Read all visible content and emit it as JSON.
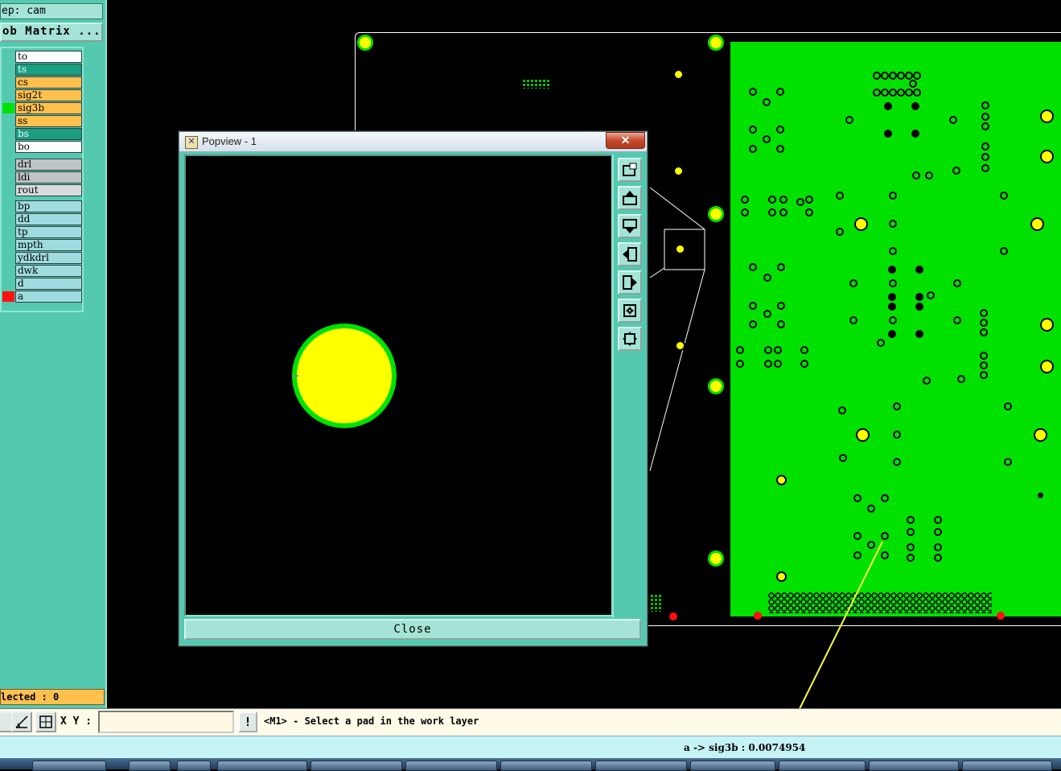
{
  "left_panel": {
    "step_label": "ep: cam",
    "matrix_button": "ob Matrix ...",
    "board_layers": [
      {
        "name": "to",
        "color": "#ffffff"
      },
      {
        "name": "ts",
        "color": "#1a9e80"
      },
      {
        "name": "cs",
        "color": "#ffc04e"
      },
      {
        "name": "sig2t",
        "color": "#ffc04e"
      },
      {
        "name": "sig3b",
        "color": "#ffc04e",
        "swatch": "#00e100"
      },
      {
        "name": "ss",
        "color": "#ffc04e"
      },
      {
        "name": "bs",
        "color": "#1a9e80"
      },
      {
        "name": "bo",
        "color": "#ffffff"
      }
    ],
    "drill_layers": [
      {
        "name": "drl",
        "color": "#bfc4c4"
      },
      {
        "name": "ldi",
        "color": "#bfc4c4"
      },
      {
        "name": "rout",
        "color": "#d8dcdc"
      }
    ],
    "misc_layers": [
      {
        "name": "bp",
        "color": "#9fdce0"
      },
      {
        "name": "dd",
        "color": "#9fdce0"
      },
      {
        "name": "tp",
        "color": "#9fdce0"
      },
      {
        "name": "mpth",
        "color": "#9fdce0"
      },
      {
        "name": "ydkdrl",
        "color": "#9fdce0"
      },
      {
        "name": "dwk",
        "color": "#9fdce0"
      },
      {
        "name": "d",
        "color": "#9fdce0"
      },
      {
        "name": "a",
        "color": "#9fdce0",
        "swatch": "#ff1010"
      }
    ],
    "selected_label": "lected : 0"
  },
  "popview": {
    "title": "Popview - 1",
    "close_label": "Close",
    "toolbar_icons": [
      "zoom-window-icon",
      "pan-up-icon",
      "pan-down-icon",
      "pan-left-icon",
      "pan-right-icon",
      "zoom-fit-icon",
      "zoom-home-icon"
    ]
  },
  "command_bar": {
    "xy_label": "X Y :",
    "xy_value": "",
    "bang_label": "!",
    "prompt": "<M1> - Select a pad in the work layer"
  },
  "status": {
    "text": "a -> sig3b : 0.0074954"
  },
  "colors": {
    "panel": "#55c9b0",
    "copper": "#00e100",
    "pad": "#ffff00",
    "annotation_arrow": "#ffff40"
  }
}
